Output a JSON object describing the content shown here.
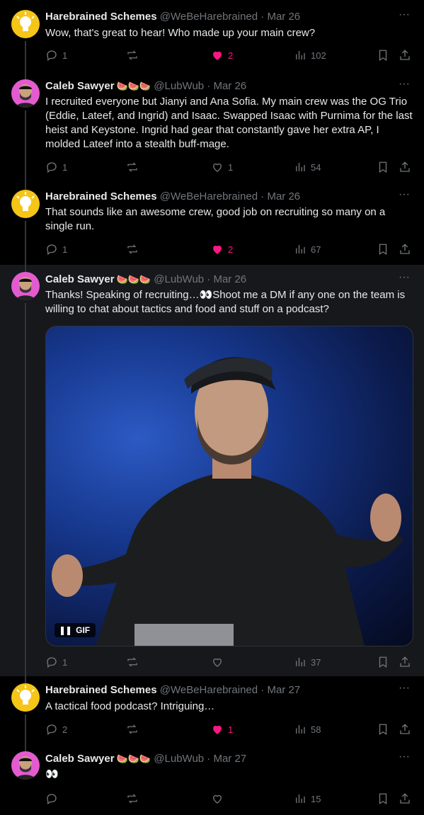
{
  "tweets": [
    {
      "name": "Harebrained Schemes",
      "badge": "",
      "handle": "@WeBeHarebrained",
      "sep": " · ",
      "date": "Mar 26",
      "text": "Wow, that's great to hear! Who made up your main crew?",
      "replies": "1",
      "reposts": "",
      "likes": "2",
      "liked": true,
      "views": "102"
    },
    {
      "name": "Caleb Sawyer",
      "badge": "🍉🍉🍉",
      "handle": "@LubWub",
      "sep": " · ",
      "date": "Mar 26",
      "text": "I recruited everyone but Jianyi and Ana Sofia. My main crew was the OG Trio (Eddie, Lateef, and Ingrid) and Isaac. Swapped Isaac with Purnima for the last heist and Keystone. Ingrid had gear that constantly gave her extra AP, I molded Lateef into a stealth buff-mage.",
      "replies": "1",
      "reposts": "",
      "likes": "1",
      "liked": false,
      "views": "54"
    },
    {
      "name": "Harebrained Schemes",
      "badge": "",
      "handle": "@WeBeHarebrained",
      "sep": " · ",
      "date": "Mar 26",
      "text": "That sounds like an awesome crew, good job on recruiting so many on a single run.",
      "replies": "1",
      "reposts": "",
      "likes": "2",
      "liked": true,
      "views": "67"
    },
    {
      "name": "Caleb Sawyer",
      "badge": "🍉🍉🍉",
      "handle": "@LubWub",
      "sep": " · ",
      "date": "Mar 26",
      "text": "Thanks! Speaking of recruiting…👀Shoot me a DM if any one on the team is willing to chat about tactics and food and stuff on a podcast?",
      "media_label": "GIF",
      "replies": "1",
      "reposts": "",
      "likes": "",
      "liked": false,
      "views": "37"
    },
    {
      "name": "Harebrained Schemes",
      "badge": "",
      "handle": "@WeBeHarebrained",
      "sep": " · ",
      "date": "Mar 27",
      "text": "A tactical food podcast? Intriguing…",
      "replies": "2",
      "reposts": "",
      "likes": "1",
      "liked": true,
      "views": "58"
    },
    {
      "name": "Caleb Sawyer",
      "badge": "🍉🍉🍉",
      "handle": "@LubWub",
      "sep": " · ",
      "date": "Mar 27",
      "text": "👀",
      "replies": "",
      "reposts": "",
      "likes": "",
      "liked": false,
      "views": "15"
    }
  ],
  "colors": {
    "background": "#000000",
    "highlight_background": "#16181c",
    "text": "#e7e9ea",
    "muted": "#71767b",
    "like": "#f91880",
    "harebrained_avatar": "#f5c518",
    "caleb_avatar": "#e45bd0"
  },
  "icons": [
    "more-icon",
    "reply-icon",
    "repost-icon",
    "like-icon",
    "views-icon",
    "bookmark-icon",
    "share-icon",
    "pause-icon"
  ]
}
